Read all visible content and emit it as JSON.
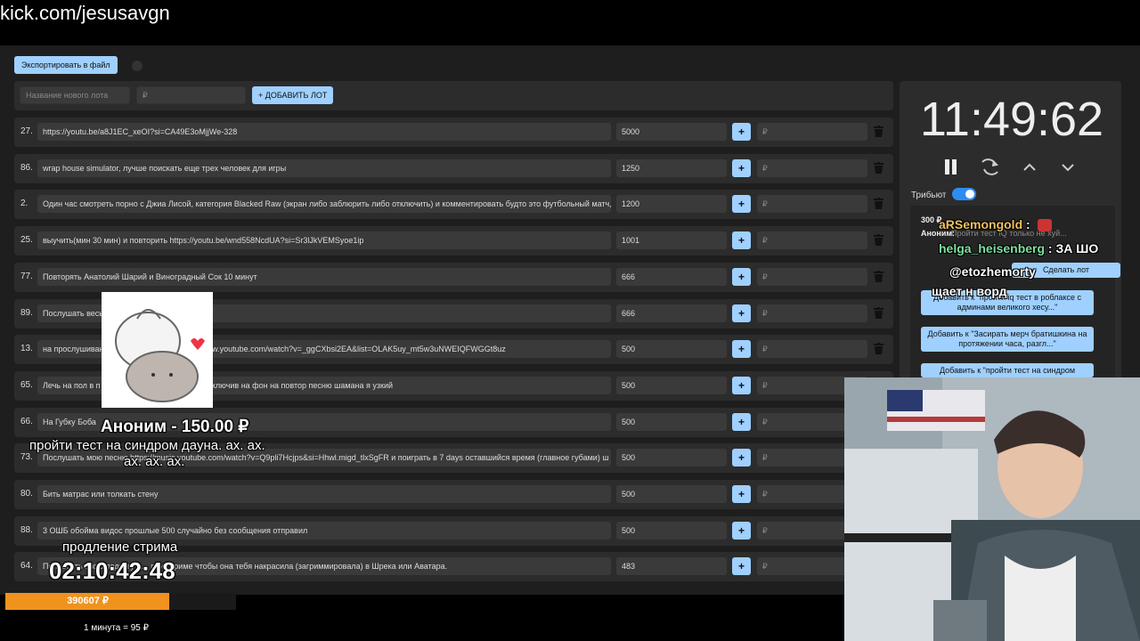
{
  "browser": {
    "url": "kick.com/jesusavgn"
  },
  "toolbar": {
    "export_label": "Экспортировать в файл"
  },
  "new_lot": {
    "name_placeholder": "Название нового лота",
    "amount_placeholder": "₽",
    "add_label": "+ ДОБАВИТЬ ЛОТ"
  },
  "lots": [
    {
      "num": "27.",
      "name": "https://youtu.be/a8J1EC_xeOI?si=CA49E3oMjjWe-328",
      "amount": "5000",
      "plus": "+",
      "rub": "₽"
    },
    {
      "num": "86.",
      "name": "wrap house simulator, лучше поискать еще трех человек для игры",
      "amount": "1250",
      "plus": "+",
      "rub": "₽"
    },
    {
      "num": "2.",
      "name": "Один час смотреть порно с Джиа Лисой, категория Blacked Raw (экран либо заблюрить либо отключить) и комментировать будто это футбольный матч, ф",
      "amount": "1200",
      "plus": "+",
      "rub": "₽"
    },
    {
      "num": "25.",
      "name": "выучить(мин 30 мин) и повторить https://youtu.be/wnd558NcdUA?si=Sr3lJkVEMSyoe1ip",
      "amount": "1001",
      "plus": "+",
      "rub": "₽"
    },
    {
      "num": "77.",
      "name": "Повторять Анатолий Шарий и Виноградный Сок 10 минут",
      "amount": "666",
      "plus": "+",
      "rub": "₽"
    },
    {
      "num": "89.",
      "name": "Послушать весь",
      "amount": "666",
      "plus": "+",
      "rub": "₽"
    },
    {
      "num": "13.",
      "name": "на прослушиван                                 СП - Свиное рыло https://www.youtube.com/watch?v=_ggCXbsi2EA&list=OLAK5uy_mt5w3uNWEIQFWGGt8uz",
      "amount": "500",
      "plus": "+",
      "rub": "₽"
    },
    {
      "num": "65.",
      "name": "Лечь на пол в п                               так лежать двадцать минут, включив на фон на повтор песню шамана я узкий",
      "amount": "500",
      "plus": "+",
      "rub": "₽"
    },
    {
      "num": "66.",
      "name": "На Губку Боба",
      "amount": "500",
      "plus": "+",
      "rub": "₽"
    },
    {
      "num": "73.",
      "name": "Послушать мою песню https://music.youtube.com/watch?v=Q9pli7Hcjps&si=Hhwl.migd_tlxSgFR и поиграть в 7 days оставшийся время (главное губами) ш",
      "amount": "500",
      "plus": "+",
      "rub": "₽"
    },
    {
      "num": "80.",
      "name": "Бить матрас или толкать стену",
      "amount": "500",
      "plus": "+",
      "rub": "₽"
    },
    {
      "num": "88.",
      "name": "3 ОШБ обойма видос прошлые 500 случайно без сообщения отправил",
      "amount": "500",
      "plus": "+",
      "rub": "₽"
    },
    {
      "num": "64.",
      "name": "Попросить свою подругу А... при стриме чтобы она тебя накрасила (загриммировала) в Шрека или Аватара.",
      "amount": "483",
      "plus": "+",
      "rub": "₽"
    }
  ],
  "timer": {
    "time": "11:49:62"
  },
  "tribute": {
    "label": "Трибьют"
  },
  "donation_panel": {
    "amount": "300 ₽",
    "donor": "Аноним:",
    "text": "Пройти тест IQ только не хуй...",
    "btn_label": "Сделать лот"
  },
  "suggestions": [
    "Добавить к \"пройти iq тест в роблаксе с админами великого хесу...\"",
    "Добавить к \"Засирать мерч братишкина на протяжении часа, разгл...\"",
    "Добавить к \"пройти тест на синдром"
  ],
  "chat": [
    {
      "user": "aRSemongold",
      "sep": " :",
      "msg": "",
      "color": "#f0c060"
    },
    {
      "user": "helga_heisenberg",
      "sep": " :",
      "msg": " ЗА ШО",
      "color": "#7fe0a0"
    },
    {
      "user": "@etozhemorty",
      "sep": "",
      "msg": "",
      "color": "#ffffff"
    },
    {
      "user": "",
      "sep": "",
      "msg": "щает н ворд",
      "color": "#ffffff"
    }
  ],
  "overlay": {
    "donor": "Аноним - 150.00 ₽",
    "message_line1": "пройти тест на синдром дауна. ах. ах.",
    "message_line2": "ах. ах. ах.",
    "extension_label": "продление стрима",
    "countdown": "02:10:42:48"
  },
  "progress": {
    "value": "390607 ₽",
    "fraction": 0.71
  },
  "rate": {
    "text": "1 минута = 95 ₽"
  },
  "colors": {
    "accent": "#9fd0ff",
    "progress": "#f0921e",
    "switch": "#2d8cf0",
    "bg": "#1e1e1e",
    "row": "#2c2c2c"
  },
  "icons": [
    "trash-icon",
    "pause-icon",
    "refresh-icon",
    "chevron-up-icon",
    "chevron-down-icon"
  ]
}
